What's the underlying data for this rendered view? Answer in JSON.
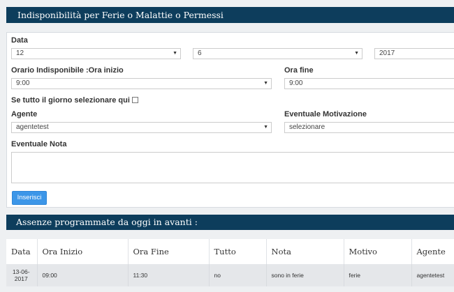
{
  "header": {
    "title": "Indisponibilità per Ferie o Malattie o Permessi"
  },
  "form": {
    "data_label": "Data",
    "day": "12",
    "month": "6",
    "year": "2017",
    "ora_inizio_label": "Orario Indisponibile :Ora inizio",
    "ora_inizio": "9:00",
    "ora_fine_label": "Ora fine",
    "ora_fine": "9:00",
    "tutto_giorno_label": "Se tutto il giorno selezionare qui",
    "agente_label": "Agente",
    "agente": "agentetest",
    "motivazione_label": "Eventuale Motivazione",
    "motivazione": "selezionare",
    "nota_label": "Eventuale Nota",
    "nota": "",
    "submit_label": "Inserisci"
  },
  "absences": {
    "title": "Assenze programmate da oggi in avanti :",
    "columns": [
      "Data",
      "Ora Inizio",
      "Ora Fine",
      "Tutto",
      "Nota",
      "Motivo",
      "Agente"
    ],
    "rows": [
      {
        "date_line1": "13-06-",
        "date_line2": "2017",
        "ora_inizio": "09:00",
        "ora_fine": "11:30",
        "tutto": "no",
        "nota": "sono in ferie",
        "motivo": "ferie",
        "agente": "agentetest"
      }
    ]
  }
}
